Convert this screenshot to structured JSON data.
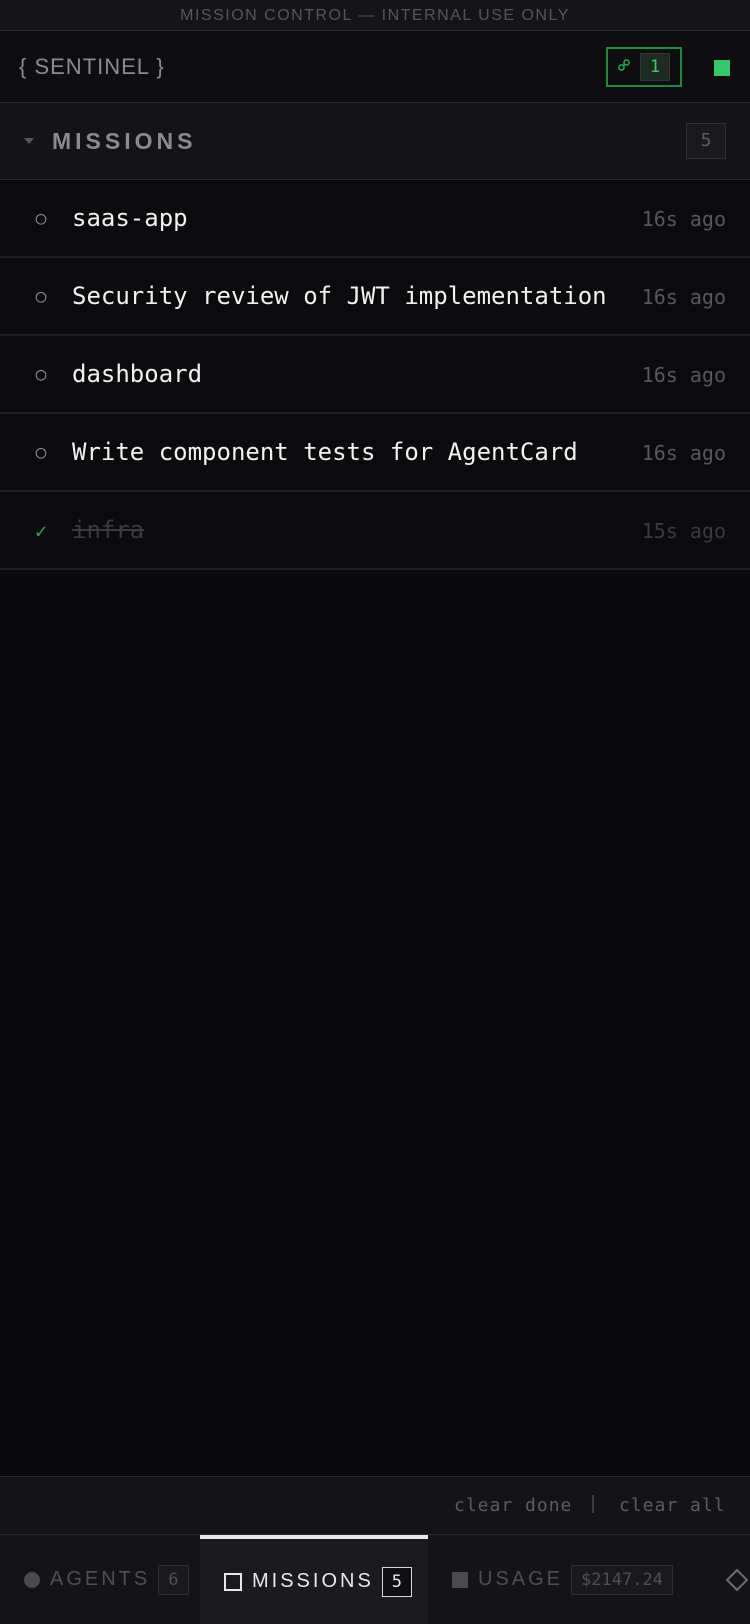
{
  "banner": {
    "text": "MISSION CONTROL — INTERNAL USE ONLY"
  },
  "header": {
    "brand": "{ SENTINEL }",
    "link_icon": "link-icon",
    "link_count": "1",
    "status_color": "#35c76a"
  },
  "section": {
    "title": "MISSIONS",
    "count": "5"
  },
  "missions": [
    {
      "status": "○",
      "title": "saas-app",
      "time": "16s ago",
      "done": false
    },
    {
      "status": "○",
      "title": "Security review of JWT implementation",
      "time": "16s ago",
      "done": false
    },
    {
      "status": "○",
      "title": "dashboard",
      "time": "16s ago",
      "done": false
    },
    {
      "status": "○",
      "title": "Write component tests for AgentCard",
      "time": "16s ago",
      "done": false
    },
    {
      "status": "✓",
      "title": "infra",
      "time": "15s ago",
      "done": true
    }
  ],
  "actions": {
    "clear_done": "clear done",
    "clear_all": "clear all"
  },
  "tabs": {
    "agents": {
      "label": "AGENTS",
      "count": "6"
    },
    "missions": {
      "label": "MISSIONS",
      "count": "5",
      "active": true
    },
    "usage": {
      "label": "USAGE",
      "amount": "$2147.24"
    }
  },
  "colors": {
    "accent_green": "#35c76a",
    "border_green": "#1f8b40",
    "background": "#0a0a0c"
  }
}
